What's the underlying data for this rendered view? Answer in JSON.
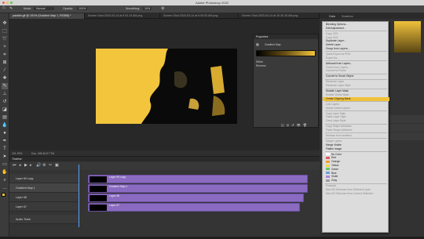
{
  "app": {
    "title": "Adobe Photoshop 2020"
  },
  "options_bar": {
    "mode_label": "Mode:",
    "mode_value": "Normal",
    "opacity_label": "Opacity:",
    "opacity_value": "100%",
    "smoothing_label": "Smoothing:",
    "smoothing_value": "10%"
  },
  "tabs": [
    {
      "label": "parallel.gif @ 191% (Gradient Map 1, RGB/8) *"
    },
    {
      "label": "Screen Shot 2020-03-14 at 9.03.13 AM.png"
    },
    {
      "label": "Screen Shot 2020-03-14 at 9.05.53 AM.png"
    },
    {
      "label": "Screen Shot 2020-03-14 at 10.26.16 AM.png"
    }
  ],
  "status": {
    "zoom": "191.29%",
    "doc": "Doc: 408.4K/2.77M"
  },
  "properties": {
    "title": "Properties",
    "type": "Gradient Map",
    "opt1": "Dither",
    "opt2": "Reverse"
  },
  "timeline": {
    "title": "Timeline",
    "tracks": [
      {
        "name": "Layer 69 copy",
        "clip": "Layer 69 copy"
      },
      {
        "name": "Gradient Map 1",
        "clip": "Gradient Map 1"
      },
      {
        "name": "Layer 68",
        "clip": "Layer 68"
      },
      {
        "name": "Layer 67",
        "clip": "Layer 67"
      }
    ],
    "audio": "Audio Track"
  },
  "right_panel": {
    "tab1": "Color",
    "tab2": "Swatches"
  },
  "context_menu": [
    {
      "label": "Blending Options...",
      "state": "normal"
    },
    {
      "label": "Edit Adjustment...",
      "state": "normal"
    },
    {
      "sep": true
    },
    {
      "label": "Copy CSS",
      "state": "disabled"
    },
    {
      "label": "Copy SVG",
      "state": "disabled"
    },
    {
      "label": "Duplicate Layer...",
      "state": "normal"
    },
    {
      "label": "Delete Layer",
      "state": "normal"
    },
    {
      "label": "Group from Layers...",
      "state": "normal"
    },
    {
      "sep": true
    },
    {
      "label": "Quick Export as PNG",
      "state": "disabled"
    },
    {
      "label": "Export As...",
      "state": "disabled"
    },
    {
      "sep": true
    },
    {
      "label": "Artboard from Layers...",
      "state": "normal"
    },
    {
      "label": "Frame from Layers...",
      "state": "disabled"
    },
    {
      "label": "Convert to Frame",
      "state": "disabled"
    },
    {
      "sep": true
    },
    {
      "label": "Convert to Smart Object",
      "state": "normal"
    },
    {
      "sep": true
    },
    {
      "label": "Rasterize Layer",
      "state": "disabled"
    },
    {
      "label": "Rasterize Layer Style",
      "state": "disabled"
    },
    {
      "sep": true
    },
    {
      "label": "Disable Layer Mask",
      "state": "normal"
    },
    {
      "label": "Enable Vector Mask",
      "state": "disabled"
    },
    {
      "label": "Create Clipping Mask",
      "state": "highlight"
    },
    {
      "sep": true
    },
    {
      "label": "Link Layers",
      "state": "disabled"
    },
    {
      "label": "Select Linked Layers",
      "state": "disabled"
    },
    {
      "sep": true
    },
    {
      "label": "Copy Layer Style",
      "state": "disabled"
    },
    {
      "label": "Paste Layer Style",
      "state": "disabled"
    },
    {
      "label": "Clear Layer Style",
      "state": "disabled"
    },
    {
      "sep": true
    },
    {
      "label": "Copy Shape Attributes",
      "state": "disabled"
    },
    {
      "label": "Paste Shape Attributes",
      "state": "disabled"
    },
    {
      "sep": true
    },
    {
      "label": "Release from Isolation",
      "state": "disabled"
    },
    {
      "sep": true
    },
    {
      "label": "Merge Layers",
      "state": "disabled"
    },
    {
      "label": "Merge Visible",
      "state": "normal"
    },
    {
      "label": "Flatten Image",
      "state": "normal"
    },
    {
      "sep": true
    },
    {
      "label": "No Color",
      "state": "normal",
      "color": "#ffffff"
    },
    {
      "label": "Red",
      "state": "normal",
      "color": "#e45a5a"
    },
    {
      "label": "Orange",
      "state": "normal",
      "color": "#f0a030"
    },
    {
      "label": "Yellow",
      "state": "normal",
      "color": "#ecd84a"
    },
    {
      "label": "Green",
      "state": "normal",
      "color": "#6cc46c"
    },
    {
      "label": "Blue",
      "state": "normal",
      "color": "#6b9fe0"
    },
    {
      "label": "Violet",
      "state": "normal",
      "color": "#a98ad8"
    },
    {
      "label": "Gray",
      "state": "normal",
      "color": "#a0a0a0"
    },
    {
      "sep": true
    },
    {
      "label": "Postcard",
      "state": "disabled"
    },
    {
      "label": "New 3D Extrusion from Selected Layer",
      "state": "disabled"
    },
    {
      "label": "New 3D Extrusion from Current Selection",
      "state": "disabled"
    }
  ],
  "colors": {
    "accent": "#f0c23c",
    "clip": "#8a6bc1",
    "image_yellow": "#f2c53d"
  }
}
